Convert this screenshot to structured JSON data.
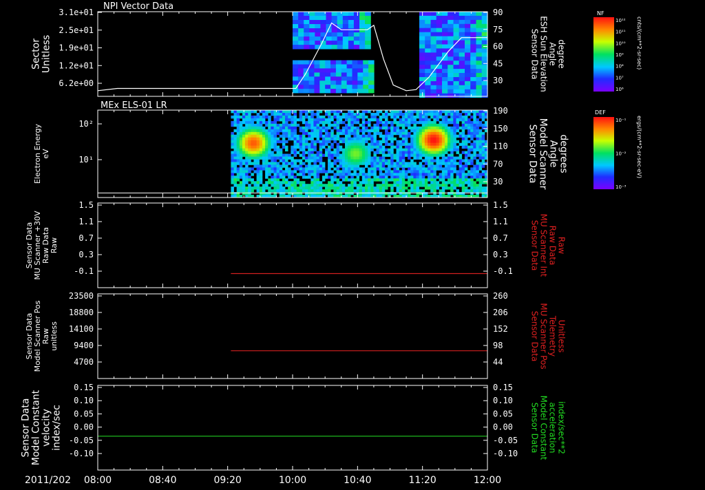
{
  "chart_data": [
    {
      "type": "heatmap",
      "title": "NPI Vector Data",
      "ylabel": [
        "Sector",
        "Unitless"
      ],
      "y_tick_labels": [
        "3.1e+01",
        "2.5e+01",
        "1.9e+01",
        "1.2e+01",
        "6.2e+00"
      ],
      "y2label": [
        "Sensor Data",
        "ESH Sun Elevation",
        "Angle",
        "degree"
      ],
      "y2_tick_labels": [
        "90",
        "75",
        "60",
        "45",
        "30"
      ],
      "y2lim": [
        15,
        90
      ],
      "colorbar": {
        "label": "NF",
        "units": "cnts/(cm**2-sr-sec)",
        "ticks": [
          "10¹²",
          "10¹¹",
          "10¹⁰",
          "10⁹",
          "10⁸",
          "10⁷",
          "10⁶"
        ]
      },
      "overlay_line": {
        "x": [
          "08:00",
          "08:12",
          "09:30",
          "10:02",
          "10:08",
          "10:18",
          "10:24",
          "10:30",
          "10:46",
          "10:50",
          "10:56",
          "11:02",
          "11:10",
          "11:16",
          "11:24",
          "11:36",
          "11:44",
          "12:00"
        ],
        "y": [
          20,
          22,
          22,
          22,
          35,
          62,
          80,
          74,
          74,
          78,
          48,
          25,
          20,
          21,
          32,
          55,
          67,
          67
        ]
      },
      "data_blocks": [
        {
          "x_start": "10:00",
          "x_end": "10:48",
          "y_start": 57,
          "y_end": 90
        },
        {
          "x_start": "10:00",
          "x_end": "10:50",
          "y_start": 18,
          "y_end": 47
        },
        {
          "x_start": "11:18",
          "x_end": "12:00",
          "y_start": 14,
          "y_end": 90
        }
      ]
    },
    {
      "type": "heatmap",
      "title": "MEx ELS-01 LR",
      "ylabel": [
        "Electron Energy",
        "eV"
      ],
      "y_tick_labels": [
        "10²",
        "10¹"
      ],
      "y2label": [
        "Sensor Data",
        "Model Scanner",
        "Angle",
        "degrees"
      ],
      "y2_tick_labels": [
        "190",
        "150",
        "110",
        "70",
        "30"
      ],
      "y2lim": [
        0,
        190
      ],
      "colorbar": {
        "label": "DEF",
        "units": "ergs/(cm**2-sr-sec-eV)",
        "ticks": [
          "10⁻¹",
          "10⁻²",
          "10⁻³"
        ]
      },
      "overlay_line": {
        "x": [
          "08:00",
          "12:00"
        ],
        "y": [
          10,
          10
        ]
      },
      "data_start": "09:22",
      "hot_spots": [
        {
          "x": "09:35",
          "y": 118,
          "intensity": 0.9
        },
        {
          "x": "11:26",
          "y": 125,
          "intensity": 1.0
        },
        {
          "x": "10:38",
          "y": 95,
          "intensity": 0.6
        }
      ]
    },
    {
      "type": "line",
      "ylabel": [
        "Sensor Data",
        "MU Scanner +30V",
        "Raw Data",
        "Raw"
      ],
      "y_tick_labels": [
        "1.5",
        "1.1",
        "0.7",
        "0.3",
        "-0.1"
      ],
      "y2label": [
        "Sensor Data",
        "MU Scanner Int",
        "Raw Data",
        "Raw"
      ],
      "y2_tick_labels": [
        "1.5",
        "1.1",
        "0.7",
        "0.3",
        "-0.1"
      ],
      "ylim": [
        -0.3,
        1.5
      ],
      "series": [
        {
          "name": "",
          "color": "#d42020",
          "x_start": "09:22",
          "x_end": "12:00",
          "value": 0.0
        }
      ]
    },
    {
      "type": "line",
      "ylabel": [
        "Sensor Data",
        "Model Scanner Pos",
        "Raw",
        "unitless"
      ],
      "y_tick_labels": [
        "23500",
        "18800",
        "14100",
        "9400",
        "4700"
      ],
      "y2label": [
        "Sensor Data",
        "MU Scanner Pos",
        "Telemetry",
        "Unitless"
      ],
      "y2_tick_labels": [
        "260",
        "206",
        "152",
        "98",
        "44"
      ],
      "ylim": [
        0,
        23500
      ],
      "series": [
        {
          "name": "",
          "color": "#d42020",
          "x_start": "09:22",
          "x_end": "12:00",
          "value": 7700
        }
      ]
    },
    {
      "type": "line",
      "ylabel": [
        "Sensor Data",
        "Model Constant",
        "velocity",
        "index/sec"
      ],
      "y_tick_labels": [
        "0.15",
        "0.10",
        "0.05",
        "0.00",
        "-0.05",
        "-0.10"
      ],
      "y2label": [
        "Sensor Data",
        "Model Constant",
        "acceleration",
        "index/sec**2"
      ],
      "y2_tick_labels": [
        "0.15",
        "0.10",
        "0.05",
        "0.00",
        "-0.05",
        "-0.10"
      ],
      "ylim": [
        -0.1,
        0.15
      ],
      "series": [
        {
          "name": "",
          "color": "#22cc22",
          "x_start": "08:00",
          "x_end": "12:00",
          "value": 0.0
        }
      ]
    }
  ],
  "time_axis": {
    "date_label": "2011/202",
    "ticks": [
      "08:00",
      "08:40",
      "09:20",
      "10:00",
      "10:40",
      "11:20",
      "12:00"
    ],
    "xlim": [
      "08:00",
      "12:00"
    ]
  }
}
